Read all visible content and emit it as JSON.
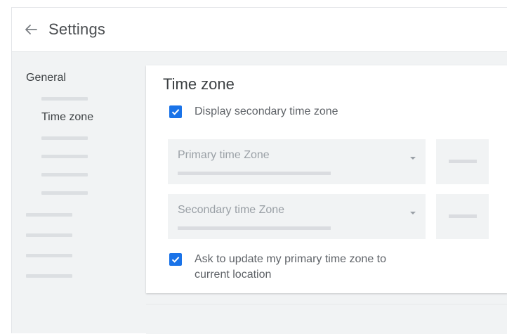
{
  "header": {
    "title": "Settings",
    "back_icon": "arrow-left-icon"
  },
  "sidebar": {
    "general_label": "General",
    "timezone_label": "Time zone"
  },
  "timezone_card": {
    "title": "Time zone",
    "display_secondary": {
      "label": "Display secondary time zone",
      "checked": true
    },
    "primary_select": {
      "label": "Primary time Zone",
      "icon": "dropdown-arrow-icon"
    },
    "secondary_select": {
      "label": "Secondary time Zone",
      "icon": "dropdown-arrow-icon"
    },
    "ask_update": {
      "label_line1": "Ask to update my primary time zone to",
      "label_line2": "current location",
      "checked": true
    }
  },
  "colors": {
    "accent": "#1a73e8",
    "background": "#f1f3f4",
    "card": "#ffffff"
  }
}
